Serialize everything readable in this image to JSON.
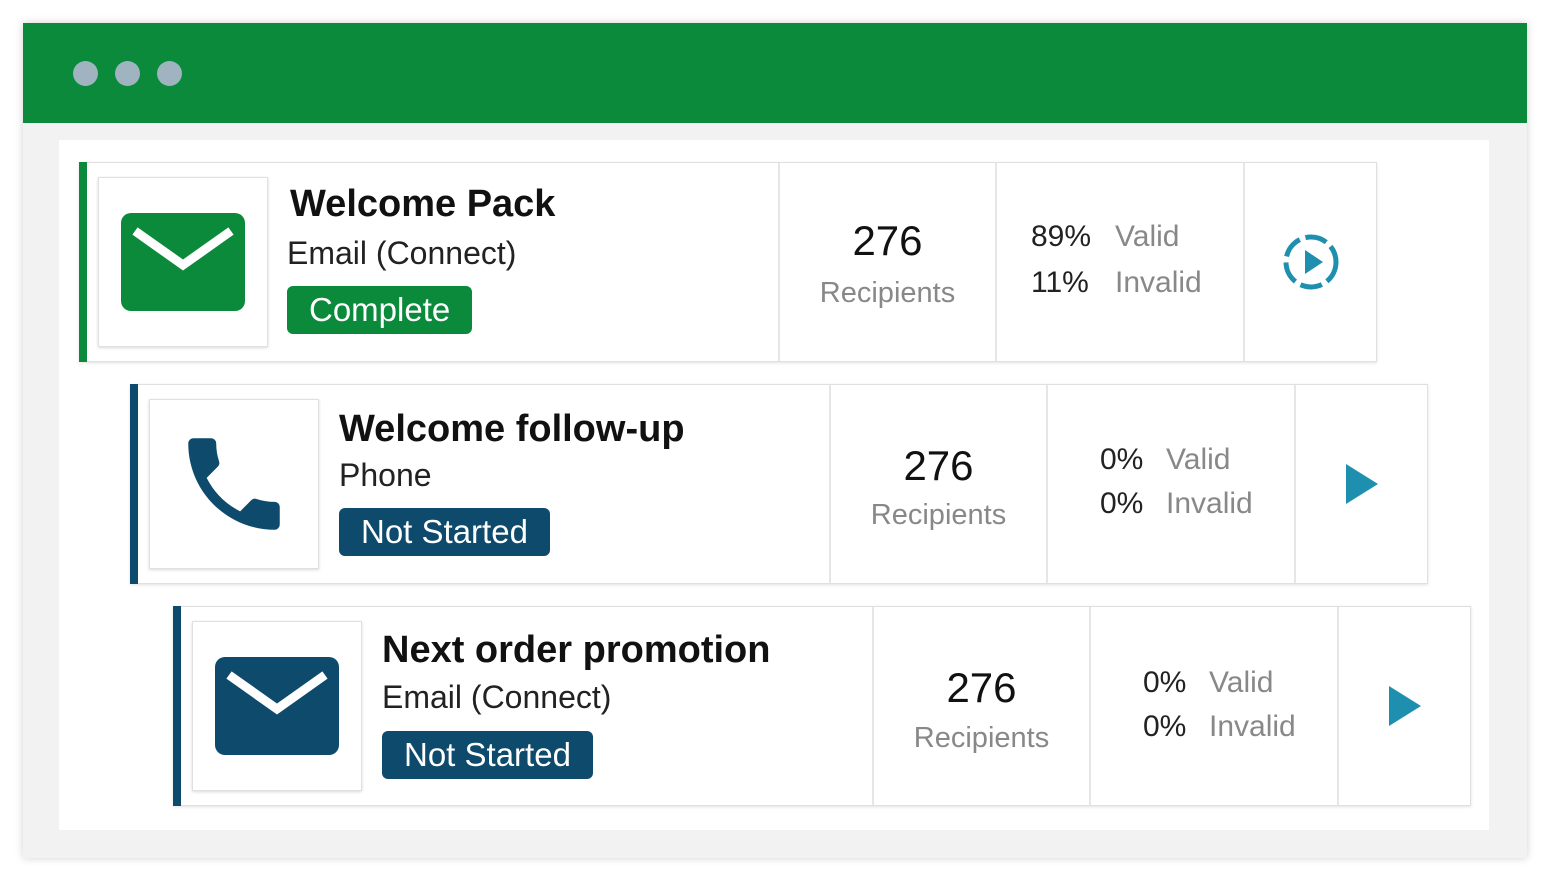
{
  "window": {
    "controls": [
      "window-dot",
      "window-dot",
      "window-dot"
    ],
    "titlebar_color": "#0a8a3a"
  },
  "campaigns": [
    {
      "title": "Welcome Pack",
      "channel": "Email (Connect)",
      "status": "Complete",
      "status_color": "#0a8a3a",
      "icon": "envelope-icon",
      "count": "276",
      "count_label": "Recipients",
      "valid_pct": "89%",
      "valid_label": "Valid",
      "invalid_pct": "11%",
      "invalid_label": "Invalid",
      "action_icon": "replay-icon"
    },
    {
      "title": "Welcome follow-up",
      "channel": "Phone",
      "status": "Not Started",
      "status_color": "#0d4a6b",
      "icon": "phone-icon",
      "count": "276",
      "count_label": "Recipients",
      "valid_pct": "0%",
      "valid_label": "Valid",
      "invalid_pct": "0%",
      "invalid_label": "Invalid",
      "action_icon": "play-icon"
    },
    {
      "title": "Next order promotion",
      "channel": "Email (Connect)",
      "status": "Not Started",
      "status_color": "#0d4a6b",
      "icon": "envelope-icon",
      "count": "276",
      "count_label": "Recipients",
      "valid_pct": "0%",
      "valid_label": "Valid",
      "invalid_pct": "0%",
      "invalid_label": "Invalid",
      "action_icon": "play-icon"
    }
  ],
  "colors": {
    "complete": "#0a8a3a",
    "not_started": "#0d4a6b",
    "action": "#1e8fae"
  }
}
